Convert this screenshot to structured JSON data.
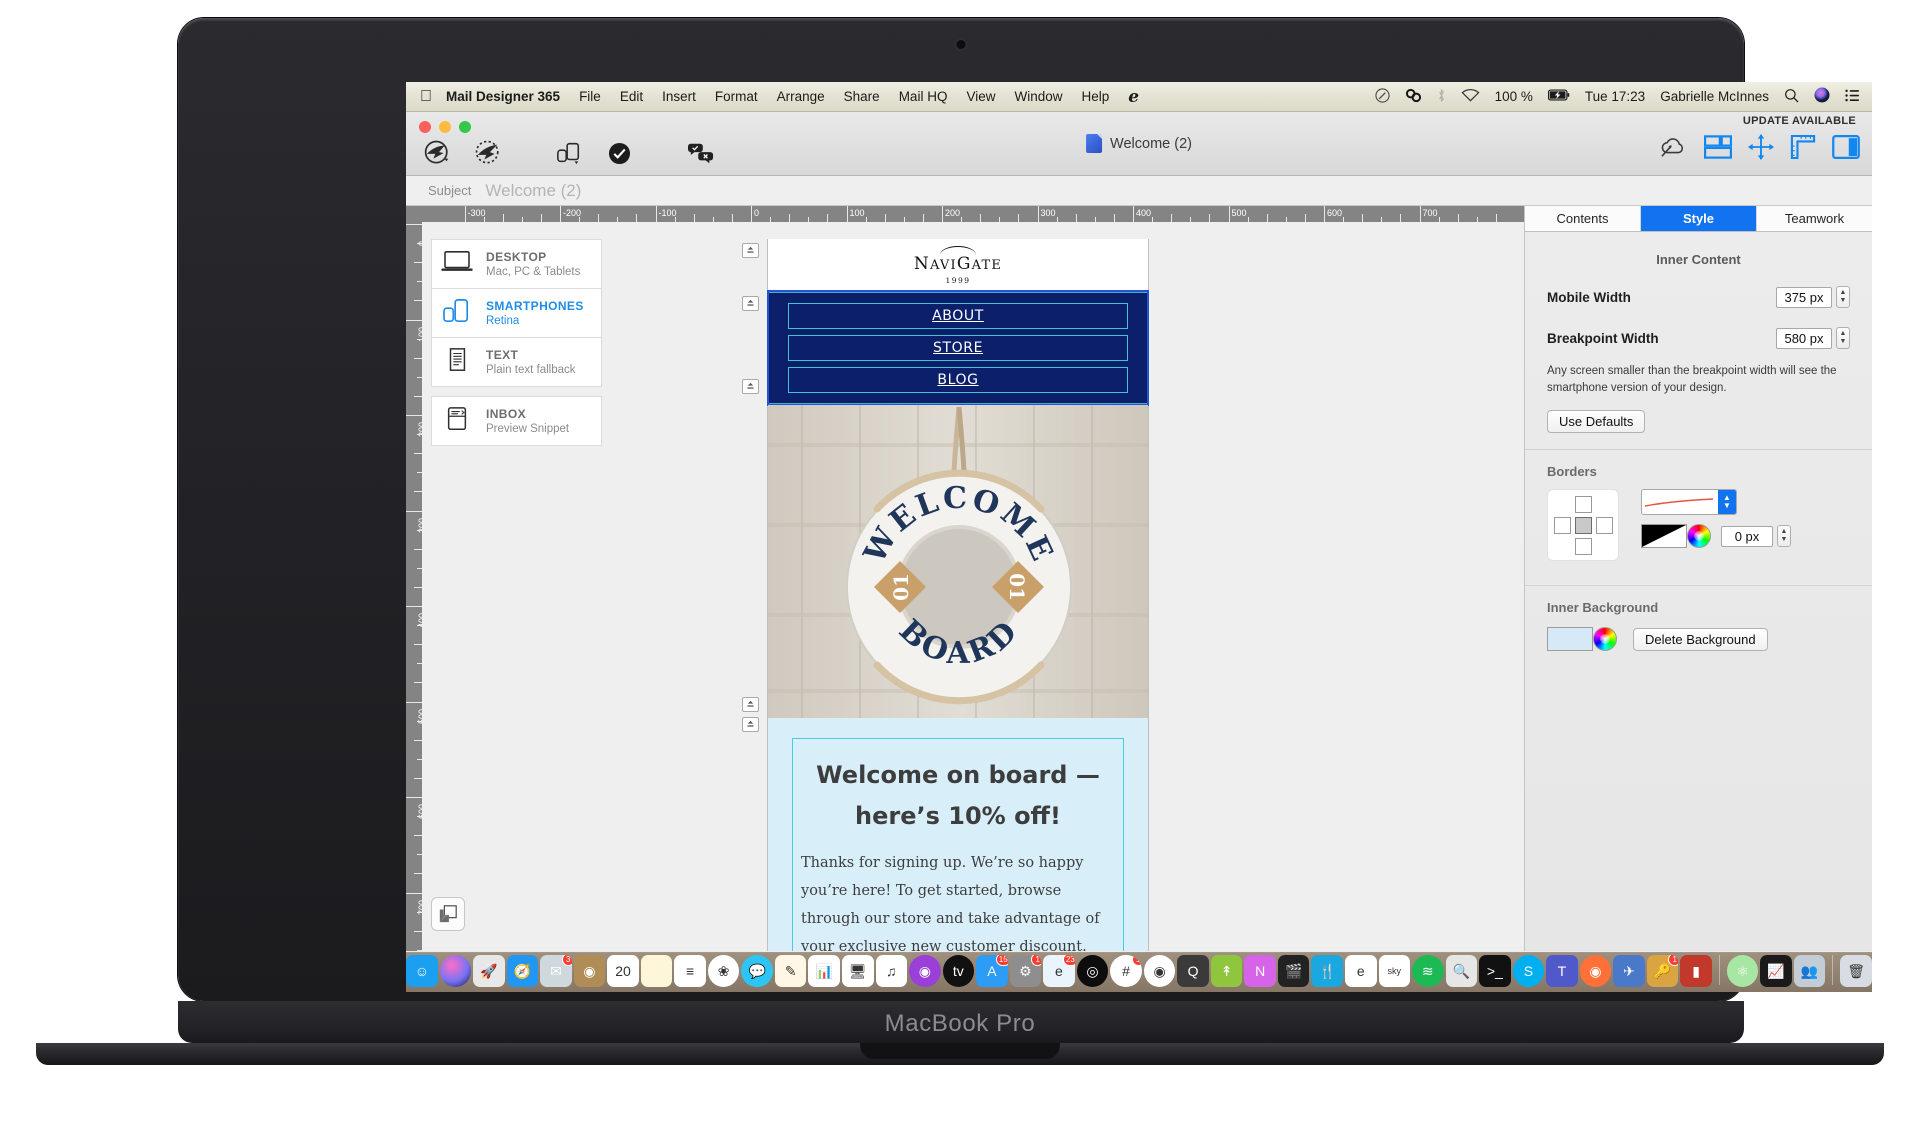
{
  "device": {
    "label": "MacBook Pro"
  },
  "menubar": {
    "apple_icon": "apple-icon",
    "app_name": "Mail Designer 365",
    "items": [
      "File",
      "Edit",
      "Insert",
      "Format",
      "Arrange",
      "Share",
      "Mail HQ",
      "View",
      "Window",
      "Help"
    ],
    "extra_glyph": "e",
    "status": {
      "battery_percent": "100 %",
      "time": "Tue 17:23",
      "user": "Gabrielle McInnes",
      "icons": [
        "pen-circle-icon",
        "creative-cloud-icon",
        "bluetooth-icon",
        "wifi-icon",
        "battery-charging-icon",
        "spotlight-search-icon",
        "siri-icon",
        "control-center-icon"
      ]
    }
  },
  "window": {
    "traffic_lights": [
      "close",
      "minimize",
      "zoom"
    ],
    "document_title": "Welcome (2)",
    "update_notice": "UPDATE AVAILABLE",
    "toolbar_left_icons": [
      "send-test-icon",
      "send-dotted-icon",
      "device-preview-icon",
      "check-circle-icon",
      "approval-comments-icon"
    ],
    "toolbar_right_icons": [
      "cloud-upload-icon",
      "layout-blocks-icon",
      "spacing-move-icon",
      "ruler-guides-icon",
      "inspector-panel-icon"
    ]
  },
  "subject": {
    "label": "Subject",
    "value": "Welcome (2)"
  },
  "rulers": {
    "horizontal": [
      "-300",
      "-200",
      "-100",
      "0",
      "100",
      "200",
      "300",
      "400",
      "500",
      "600",
      "700"
    ],
    "vertical": [
      "0",
      "100",
      "200",
      "300",
      "400",
      "500",
      "600",
      "700"
    ]
  },
  "device_list": [
    {
      "icon": "laptop-icon",
      "title": "DESKTOP",
      "subtitle": "Mac, PC & Tablets",
      "active": false
    },
    {
      "icon": "smartphone-icon",
      "title": "SMARTPHONES",
      "subtitle": "Retina",
      "active": true
    },
    {
      "icon": "text-doc-icon",
      "title": "TEXT",
      "subtitle": "Plain text fallback",
      "active": false
    },
    {
      "icon": "inbox-icon",
      "title": "INBOX",
      "subtitle": "Preview Snippet",
      "active": false
    }
  ],
  "email": {
    "logo": {
      "name_part1": "N",
      "name_part2": "avi",
      "name_part3": "G",
      "name_part4": "ate",
      "full": "NAVIGATE",
      "year": "1999"
    },
    "nav_buttons": [
      "ABOUT",
      "STORE",
      "BLOG"
    ],
    "hero_alt": "life-ring-welcome-aboard-image",
    "hero_text_top": "WELCOME",
    "hero_text_bottom": "BOARD",
    "hero_ring_number": "01",
    "headline_line1": "Welcome on board —",
    "headline_line2": "here’s 10% off!",
    "body": "Thanks for signing up. We’re so happy you’re here! To get started, browse through our store and take advantage of your exclusive new customer discount."
  },
  "inspector": {
    "tabs": [
      {
        "label": "Contents",
        "selected": false
      },
      {
        "label": "Style",
        "selected": true
      },
      {
        "label": "Teamwork",
        "selected": false
      }
    ],
    "inner_content": {
      "section_title": "Inner Content",
      "mobile_width_label": "Mobile Width",
      "mobile_width_value": "375 px",
      "breakpoint_width_label": "Breakpoint Width",
      "breakpoint_width_value": "580 px",
      "hint": "Any screen smaller than the breakpoint width will see the smartphone version of your design.",
      "use_defaults_label": "Use Defaults"
    },
    "borders": {
      "title": "Borders",
      "width_value": "0 px"
    },
    "inner_background": {
      "title": "Inner Background",
      "delete_label": "Delete Background",
      "swatch_color": "#d6e9f7"
    }
  },
  "colors": {
    "accent_blue": "#1273f0",
    "nav_navy": "#0b1f6b",
    "nav_border_cyan": "#41c3d6",
    "text_bg": "#d8effa",
    "link_blue": "#1f8ce8"
  },
  "dock": {
    "items": [
      {
        "name": "finder-icon",
        "bg": "#1b9ff0",
        "glyph": "☺",
        "dot": true,
        "badge": null
      },
      {
        "name": "siri-icon",
        "bg": "radial",
        "glyph": "",
        "dot": false,
        "badge": null
      },
      {
        "name": "launchpad-icon",
        "bg": "#e8e8e8",
        "glyph": "🚀",
        "dot": false,
        "badge": null
      },
      {
        "name": "safari-icon",
        "bg": "#2196f3",
        "glyph": "🧭",
        "dot": true,
        "badge": null
      },
      {
        "name": "mail-icon",
        "bg": "#cfd8dc",
        "glyph": "✉",
        "dot": true,
        "badge": "3"
      },
      {
        "name": "contacts-icon",
        "bg": "#b08d57",
        "glyph": "◉",
        "dot": false,
        "badge": null
      },
      {
        "name": "calendar-icon",
        "bg": "#ffffff",
        "glyph": "20",
        "dot": false,
        "badge": null
      },
      {
        "name": "notes-icon",
        "bg": "#fdf6d8",
        "glyph": "",
        "dot": true,
        "badge": null
      },
      {
        "name": "reminders-icon",
        "bg": "#ffffff",
        "glyph": "≡",
        "dot": false,
        "badge": null
      },
      {
        "name": "photos-icon",
        "bg": "#ffffff",
        "glyph": "❀",
        "dot": false,
        "badge": null
      },
      {
        "name": "messages-icon",
        "bg": "#2dc5f6",
        "glyph": "💬",
        "dot": false,
        "badge": null
      },
      {
        "name": "pages-icon",
        "bg": "#fff7e6",
        "glyph": "✎",
        "dot": false,
        "badge": null
      },
      {
        "name": "numbers-icon",
        "bg": "#ffffff",
        "glyph": "📊",
        "dot": false,
        "badge": null
      },
      {
        "name": "keynote-icon",
        "bg": "#ffffff",
        "glyph": "🖥",
        "dot": false,
        "badge": null
      },
      {
        "name": "itunes-icon",
        "bg": "#ffffff",
        "glyph": "♫",
        "dot": false,
        "badge": null
      },
      {
        "name": "podcasts-icon",
        "bg": "#9b40d6",
        "glyph": "◉",
        "dot": false,
        "badge": null
      },
      {
        "name": "apple-tv-icon",
        "bg": "#111111",
        "glyph": "tv",
        "dot": false,
        "badge": null
      },
      {
        "name": "app-store-icon",
        "bg": "#2d9cf5",
        "glyph": "A",
        "dot": false,
        "badge": "15"
      },
      {
        "name": "system-preferences-icon",
        "bg": "#8e8e8e",
        "glyph": "⚙",
        "dot": false,
        "badge": "1"
      },
      {
        "name": "mail-designer-icon",
        "bg": "#e9f4fd",
        "glyph": "e",
        "dot": true,
        "badge": "23"
      },
      {
        "name": "dark-target-icon",
        "bg": "#0d0d0d",
        "glyph": "◎",
        "dot": false,
        "badge": null
      },
      {
        "name": "slack-icon",
        "bg": "#ffffff",
        "glyph": "#",
        "dot": true,
        "badge": "1"
      },
      {
        "name": "chrome-icon",
        "bg": "#ffffff",
        "glyph": "◉",
        "dot": true,
        "badge": null
      },
      {
        "name": "quicktime-icon",
        "bg": "#3a3a3a",
        "glyph": "Q",
        "dot": false,
        "badge": null
      },
      {
        "name": "hype-icon",
        "bg": "#8fc63d",
        "glyph": "↟",
        "dot": true,
        "badge": null
      },
      {
        "name": "affinity-photo-icon",
        "bg": "#d664e8",
        "glyph": "N",
        "dot": true,
        "badge": null
      },
      {
        "name": "final-cut-icon",
        "bg": "#222222",
        "glyph": "🎬",
        "dot": false,
        "badge": null
      },
      {
        "name": "fork-icon",
        "bg": "#1ba7e0",
        "glyph": "🍴",
        "dot": true,
        "badge": null
      },
      {
        "name": "e-red-icon",
        "bg": "#ffffff",
        "glyph": "e",
        "dot": false,
        "badge": null
      },
      {
        "name": "sky-icon",
        "bg": "#ffffff",
        "glyph": "sky",
        "dot": false,
        "badge": null
      },
      {
        "name": "spotify-icon",
        "bg": "#1db954",
        "glyph": "≋",
        "dot": true,
        "badge": null
      },
      {
        "name": "preview-icon",
        "bg": "#e6e6e6",
        "glyph": "🔍",
        "dot": true,
        "badge": null
      },
      {
        "name": "terminal-icon",
        "bg": "#111111",
        "glyph": ">_",
        "dot": true,
        "badge": null
      },
      {
        "name": "skype-icon",
        "bg": "#00aff0",
        "glyph": "S",
        "dot": true,
        "badge": null
      },
      {
        "name": "teams-icon",
        "bg": "#5059c9",
        "glyph": "T",
        "dot": true,
        "badge": null
      },
      {
        "name": "firefox-icon",
        "bg": "#ff7139",
        "glyph": "◉",
        "dot": true,
        "badge": null
      },
      {
        "name": "airmail-icon",
        "bg": "#4a79c9",
        "glyph": "✈",
        "dot": true,
        "badge": null
      },
      {
        "name": "keychain-icon",
        "bg": "#d9a441",
        "glyph": "🔑",
        "dot": true,
        "badge": "1"
      },
      {
        "name": "red-app-icon",
        "bg": "#c0392b",
        "glyph": "▮",
        "dot": true,
        "badge": null
      },
      {
        "name": "atom-icon",
        "bg": "#a8e6a3",
        "glyph": "⚛",
        "dot": true,
        "badge": null
      },
      {
        "name": "activity-monitor-icon",
        "bg": "#1a1a1a",
        "glyph": "📈",
        "dot": true,
        "badge": null
      },
      {
        "name": "shared-drive-icon",
        "bg": "#c3cdd6",
        "glyph": "👥",
        "dot": false,
        "badge": null
      },
      {
        "name": "trash-icon",
        "bg": "#d7dde2",
        "glyph": "🗑",
        "dot": false,
        "badge": null
      }
    ]
  }
}
